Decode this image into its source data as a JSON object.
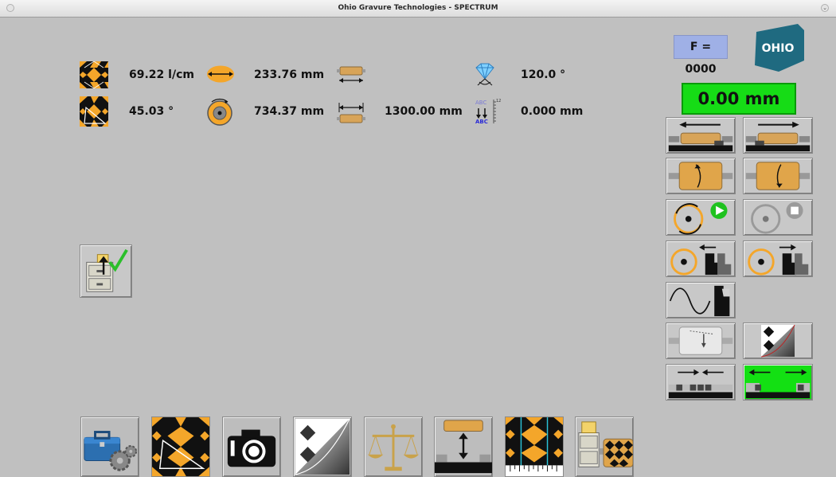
{
  "window": {
    "title": "Ohio Gravure Technologies - SPECTRUM"
  },
  "readouts": {
    "screen_ruling": "69.22 l/cm",
    "screen_angle": "45.03 °",
    "cylinder_diameter": "233.76 mm",
    "cylinder_circumference": "734.37 mm",
    "face_length": "1300.00 mm",
    "stylus_angle": "120.0 °",
    "abc_offset": "0.000 mm"
  },
  "status": {
    "f_value": "F = 0000",
    "position": "0.00 mm",
    "position_color": "#16dc16"
  },
  "logo": {
    "text": "OHIO",
    "color": "#1f6a80"
  },
  "colors": {
    "orange": "#f4a62a",
    "black": "#111111",
    "active_green": "#13e013",
    "background": "#c0c0c0"
  }
}
